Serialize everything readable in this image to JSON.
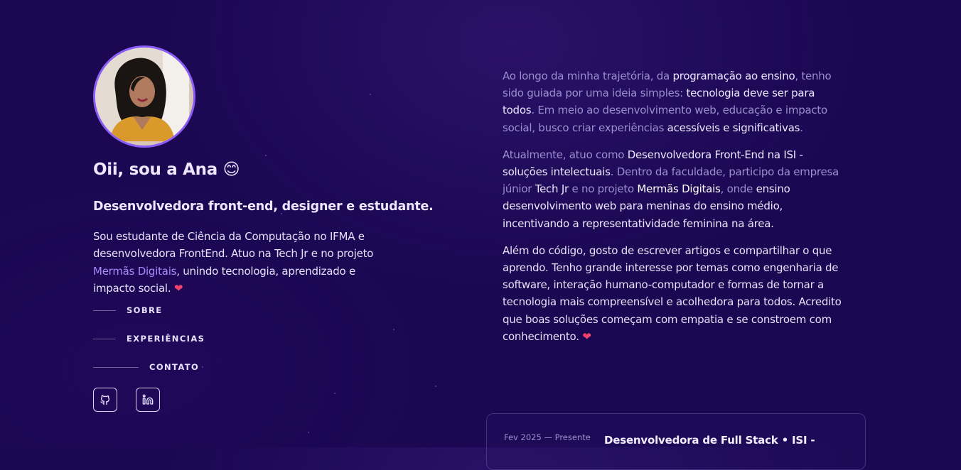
{
  "profile": {
    "greeting": "Oii, sou a Ana 😊",
    "role": "Desenvolvedora front-end, designer e estudante.",
    "bio": {
      "part1": "Sou estudante de Ciência da Computação no IFMA e desenvolvedora FrontEnd. Atuo na Tech Jr e no projeto ",
      "link": "Mermãs Digitais",
      "part2": ", unindo tecnologia, aprendizado e impacto social. ",
      "emoji": "❤"
    }
  },
  "nav": {
    "items": [
      {
        "label": "SOBRE"
      },
      {
        "label": "EXPERIÊNCIAS"
      },
      {
        "label": "CONTATO"
      }
    ]
  },
  "social": {
    "github_icon": "github-icon",
    "linkedin_icon": "linkedin-icon"
  },
  "about": {
    "p1": {
      "a": "Ao longo da minha trajetória, da ",
      "b": "programação ao ensino",
      "c": ", tenho sido guiada por uma ideia simples: ",
      "d": "tecnologia deve ser para todos",
      "e": ". Em meio ao desenvolvimento web, educação e impacto social, busco criar experiências ",
      "f": "acessíveis e significativas",
      "g": "."
    },
    "p2": {
      "a": "Atualmente, atuo como ",
      "b": "Desenvolvedora Front-End na ISI - soluções intelectuais",
      "c": ". Dentro da faculdade, participo da empresa júnior ",
      "d": "Tech Jr",
      "e": " e no projeto ",
      "f": "Mermãs Digitais",
      "g": ", onde ",
      "h": "ensino desenvolvimento web para meninas do ensino médio, incentivando a representatividade feminina na área."
    },
    "p3": {
      "text": "Além do código, gosto de escrever artigos e compartilhar o que aprendo. Tenho grande interesse por temas como engenharia de software, interação humano-computador e formas de tornar a tecnologia mais compreensível e acolhedora para todos. Acredito que boas soluções começam com empatia e se constroem com conhecimento. ",
      "emoji": "❤"
    }
  },
  "experience": {
    "date": "Fev 2025 — Presente",
    "title": "Desenvolvedora de Full Stack • ISI -"
  },
  "colors": {
    "background": "#1b0752",
    "accent": "#8b5cf6",
    "link": "#a78bfa",
    "heart": "#f0426d"
  }
}
